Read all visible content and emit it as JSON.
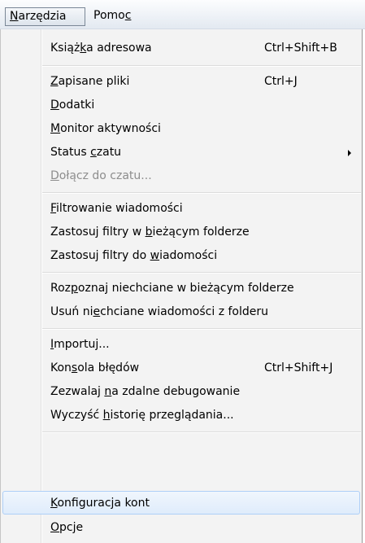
{
  "menubar": {
    "tools_parts": [
      "N",
      "arzędzia"
    ],
    "help_parts": [
      "Pomo",
      "c",
      ""
    ]
  },
  "menu": {
    "items": [
      {
        "parts": [
          "Książ",
          "k",
          "a adresowa"
        ],
        "shortcut": "Ctrl+Shift+B"
      },
      {
        "parts": [
          "",
          "Z",
          "apisane pliki"
        ],
        "shortcut": "Ctrl+J"
      },
      {
        "parts": [
          "",
          "D",
          "odatki"
        ]
      },
      {
        "parts": [
          "",
          "M",
          "onitor aktywności"
        ]
      },
      {
        "parts": [
          "Status ",
          "c",
          "zatu"
        ],
        "submenu": true
      },
      {
        "parts": [
          "",
          "D",
          "ołącz do czatu..."
        ],
        "disabled": true
      },
      {
        "parts": [
          "",
          "F",
          "iltrowanie wiadomości"
        ]
      },
      {
        "parts": [
          "Zastosuj filtry w ",
          "b",
          "ieżącym folderze"
        ]
      },
      {
        "parts": [
          "Zastosuj filtry do ",
          "w",
          "iadomości"
        ]
      },
      {
        "parts": [
          "Roz",
          "p",
          "oznaj niechciane w bieżącym folderze"
        ]
      },
      {
        "parts": [
          "Usuń ni",
          "e",
          "chciane wiadomości z folderu"
        ]
      },
      {
        "parts": [
          "",
          "I",
          "mportuj..."
        ]
      },
      {
        "parts": [
          "Kon",
          "s",
          "ola błędów"
        ],
        "shortcut": "Ctrl+Shift+J"
      },
      {
        "parts": [
          "Zezwalaj ",
          "n",
          "a zdalne debugowanie"
        ]
      },
      {
        "parts": [
          "Wyczyść ",
          "h",
          "istorię przeglądania..."
        ]
      },
      {
        "parts": [
          "",
          "K",
          "onfiguracja kont"
        ],
        "highlighted": true
      },
      {
        "parts": [
          "",
          "O",
          "pcje"
        ]
      }
    ]
  }
}
